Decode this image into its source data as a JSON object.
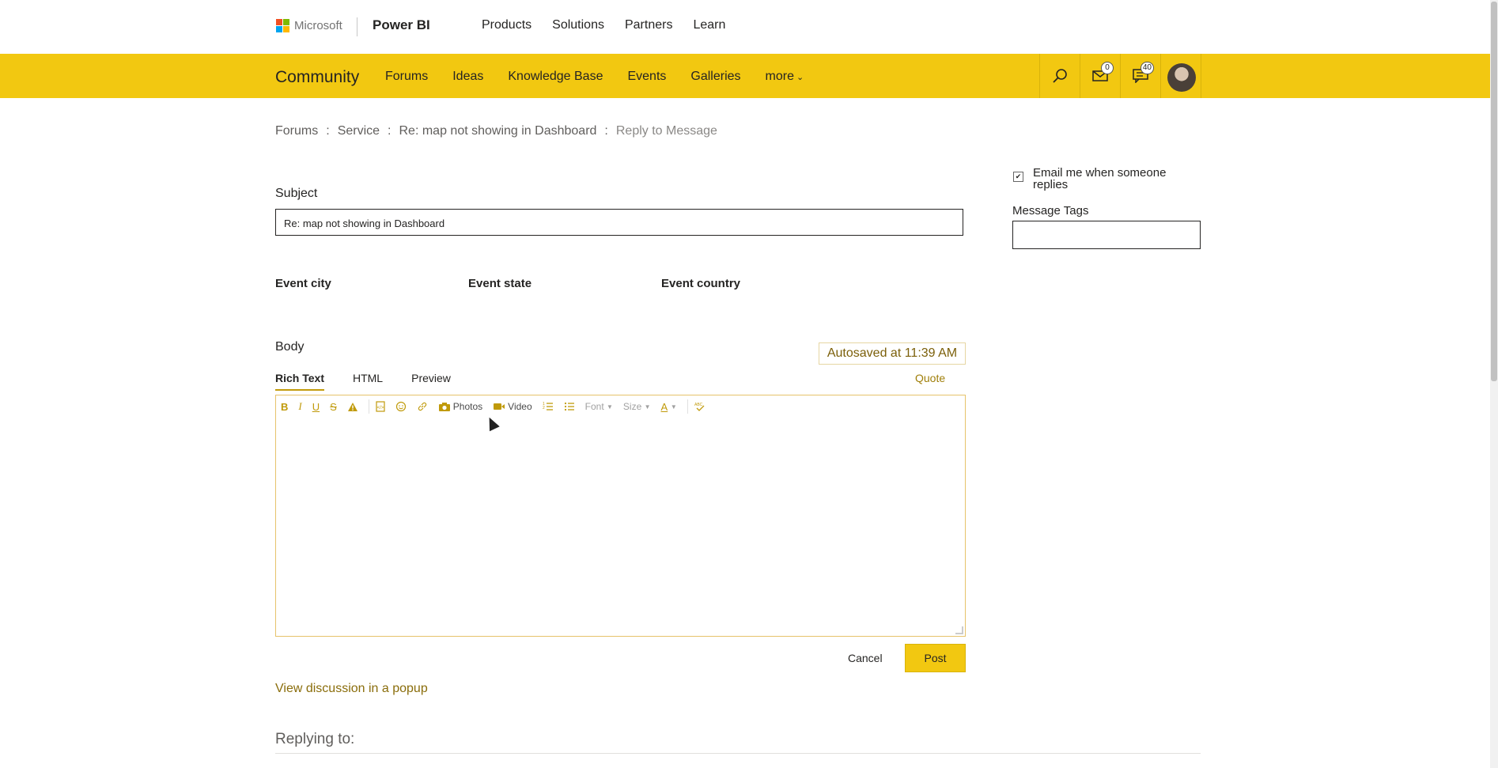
{
  "header": {
    "brand": "Microsoft",
    "product": "Power BI",
    "nav": [
      "Products",
      "Solutions",
      "Partners",
      "Learn"
    ]
  },
  "community_bar": {
    "title": "Community",
    "nav": [
      "Forums",
      "Ideas",
      "Knowledge Base",
      "Events",
      "Galleries",
      "more"
    ],
    "icons": [
      "search-icon",
      "mail-icon",
      "notifications-icon",
      "user-avatar"
    ],
    "mail_count": "0",
    "notification_count": "40"
  },
  "breadcrumb": {
    "items": [
      "Forums",
      "Service",
      "Re: map not showing in Dashboard",
      "Reply to Message"
    ],
    "separator": ":"
  },
  "form": {
    "subject_label": "Subject",
    "subject_value": "Re: map not showing in Dashboard",
    "event_city_label": "Event city",
    "event_state_label": "Event state",
    "event_country_label": "Event country",
    "body_label": "Body",
    "autosave_text": "Autosaved at 11:39 AM",
    "tabs": [
      "Rich Text",
      "HTML",
      "Preview"
    ],
    "quote_label": "Quote",
    "toolbar": {
      "bold": "B",
      "italic": "I",
      "underline": "U",
      "strike": "S",
      "photos": "Photos",
      "video": "Video",
      "font": "Font",
      "size": "Size",
      "text_color": "A"
    },
    "cancel_label": "Cancel",
    "post_label": "Post",
    "popup_link": "View discussion in a popup",
    "replying_to": "Replying to:"
  },
  "sidebar": {
    "email_checkbox_checked": true,
    "email_label": "Email me when someone replies",
    "tags_label": "Message Tags",
    "tags_value": ""
  },
  "colors": {
    "accent": "#f2c811",
    "link": "#8a6d0b"
  }
}
